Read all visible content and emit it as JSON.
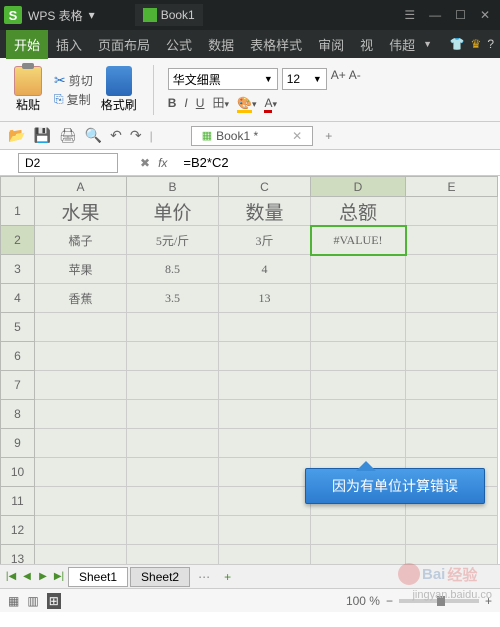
{
  "app": {
    "name": "WPS 表格",
    "doc": "Book1"
  },
  "win": {
    "min": "—",
    "max": "☐",
    "close": "✕",
    "opts": "☰"
  },
  "menus": [
    "开始",
    "插入",
    "页面布局",
    "公式",
    "数据",
    "表格样式",
    "审阅",
    "视",
    "伟超"
  ],
  "ribbon": {
    "paste": "粘贴",
    "cut": "剪切",
    "copy": "复制",
    "format": "格式刷",
    "font_name": "华文细黑",
    "font_size": "12",
    "Aplus": "A+",
    "Aminus": "A-",
    "B": "B",
    "I": "I",
    "U": "U"
  },
  "doctab": {
    "name": "Book1 *",
    "close": "✕",
    "add": "+"
  },
  "formula": {
    "name_box": "D2",
    "fx": "fx",
    "text": "=B2*C2"
  },
  "cols": [
    "A",
    "B",
    "C",
    "D",
    "E"
  ],
  "rows": [
    "1",
    "2",
    "3",
    "4",
    "5",
    "6",
    "7",
    "8",
    "9",
    "10",
    "11",
    "12",
    "13"
  ],
  "cells": {
    "A1": "水果",
    "B1": "单价",
    "C1": "数量",
    "D1": "总额",
    "A2": "橘子",
    "B2": "5元/斤",
    "C2": "3斤",
    "D2": "#VALUE!",
    "A3": "苹果",
    "B3": "8.5",
    "C3": "4",
    "A4": "香蕉",
    "B4": "3.5",
    "C4": "13"
  },
  "callout": "因为有单位计算错误",
  "sheets": {
    "s1": "Sheet1",
    "s2": "Sheet2",
    "add": "+"
  },
  "status": {
    "zoom": "100 %"
  },
  "watermark": {
    "text1": "Bai",
    "text2": "经验",
    "url": "jingyan.baidu.co"
  }
}
